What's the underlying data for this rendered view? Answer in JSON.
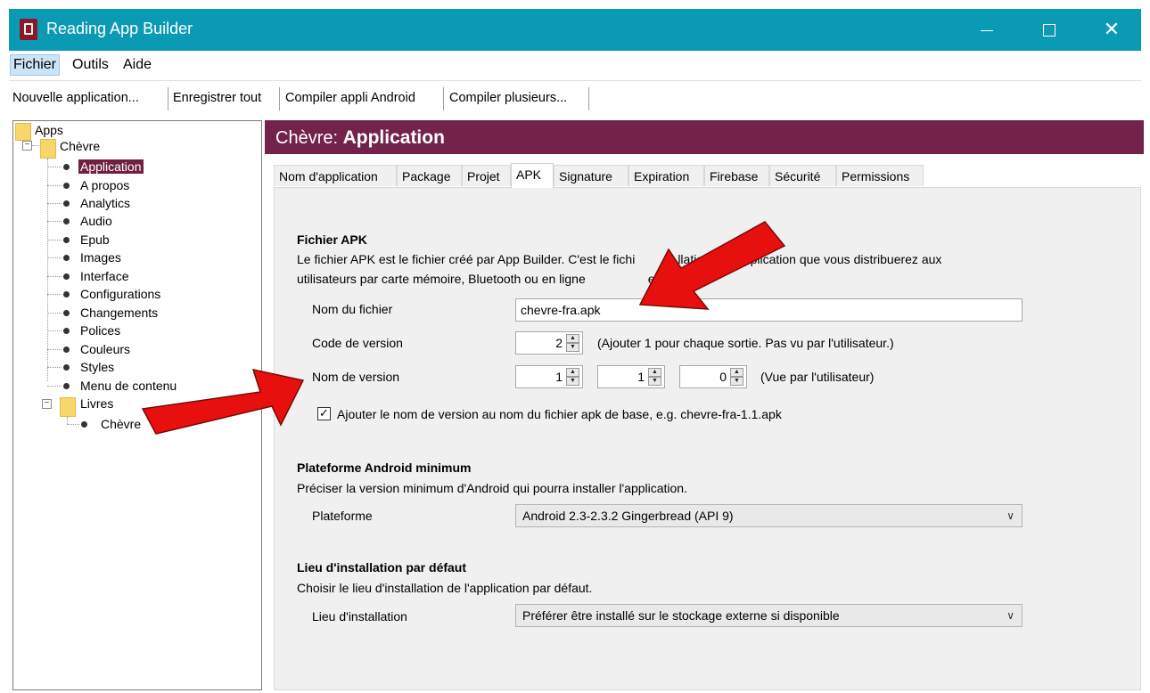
{
  "window": {
    "title": "Reading App Builder",
    "close_glyph": "✕"
  },
  "menu": {
    "items": [
      "Fichier",
      "Outils",
      "Aide"
    ]
  },
  "toolbar": {
    "buttons": [
      "Nouvelle application...",
      "Enregistrer tout",
      "Compiler appli Android",
      "Compiler plusieurs..."
    ]
  },
  "tree": {
    "root": "Apps",
    "app": "Chèvre",
    "items": [
      "Application",
      "A propos",
      "Analytics",
      "Audio",
      "Epub",
      "Images",
      "Interface",
      "Configurations",
      "Changements",
      "Polices",
      "Couleurs",
      "Styles",
      "Menu de contenu"
    ],
    "books_folder": "Livres",
    "books": [
      "Chèvre"
    ],
    "selected": "Application"
  },
  "panel": {
    "title_prefix": "Chèvre: ",
    "title_main": "Application"
  },
  "tabs": [
    "Nom d'application",
    "Package",
    "Projet",
    "APK",
    "Signature",
    "Expiration",
    "Firebase",
    "Sécurité",
    "Permissions"
  ],
  "active_tab": "APK",
  "apk": {
    "heading": "Fichier APK",
    "desc_line1": "Le fichier APK est le fichier créé par App Builder. C'est le fichi",
    "desc_line1_b": "llation de l'application que vous distribuerez aux",
    "desc_line2": "utilisateurs par carte mémoire, Bluetooth ou en ligne",
    "desc_line2_b": "e Play.",
    "filename_label": "Nom du fichier",
    "filename_value": "chevre-fra.apk",
    "version_code_label": "Code de version",
    "version_code_value": "2",
    "version_code_hint": "(Ajouter 1 pour chaque sortie. Pas vu par l'utilisateur.)",
    "version_name_label": "Nom de version",
    "version_major": "1",
    "version_minor": "1",
    "version_patch": "0",
    "version_name_hint": "(Vue par l'utilisateur)",
    "append_checkbox_label": "Ajouter le nom de version au nom du fichier apk de base, e.g. chevre-fra-1.1.apk",
    "append_checked": true
  },
  "platform": {
    "heading": "Plateforme Android minimum",
    "desc": "Préciser la version minimum d'Android qui pourra installer l'application.",
    "label": "Plateforme",
    "value": "Android 2.3-2.3.2 Gingerbread (API 9)"
  },
  "install": {
    "heading": "Lieu d'installation par défaut",
    "desc": "Choisir le lieu d'installation de l'application par défaut.",
    "label": "Lieu d'installation",
    "value": "Préférer être installé sur le stockage externe si disponible"
  },
  "colors": {
    "titlebar": "#0b9ab3",
    "accent": "#732249",
    "arrow": "#e8100f"
  }
}
